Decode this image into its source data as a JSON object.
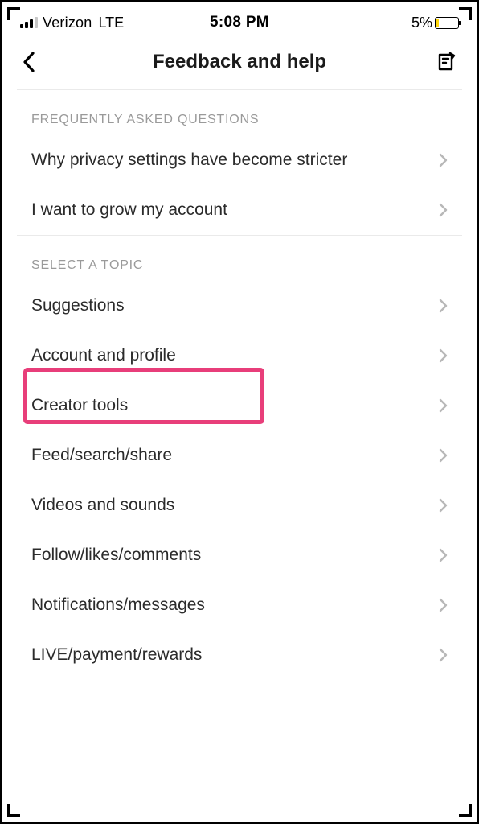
{
  "status_bar": {
    "carrier": "Verizon",
    "network": "LTE",
    "time": "5:08 PM",
    "battery_pct": "5%"
  },
  "nav": {
    "title": "Feedback and help"
  },
  "sections": {
    "faq": {
      "header": "FREQUENTLY ASKED QUESTIONS",
      "items": [
        {
          "label": "Why privacy settings have become stricter"
        },
        {
          "label": "I want to grow my account"
        }
      ]
    },
    "topics": {
      "header": "SELECT A TOPIC",
      "items": [
        {
          "label": "Suggestions"
        },
        {
          "label": "Account and profile"
        },
        {
          "label": "Creator tools"
        },
        {
          "label": "Feed/search/share"
        },
        {
          "label": "Videos and sounds"
        },
        {
          "label": "Follow/likes/comments"
        },
        {
          "label": "Notifications/messages"
        },
        {
          "label": "LIVE/payment/rewards"
        }
      ]
    }
  },
  "highlight_topic_index": 1
}
